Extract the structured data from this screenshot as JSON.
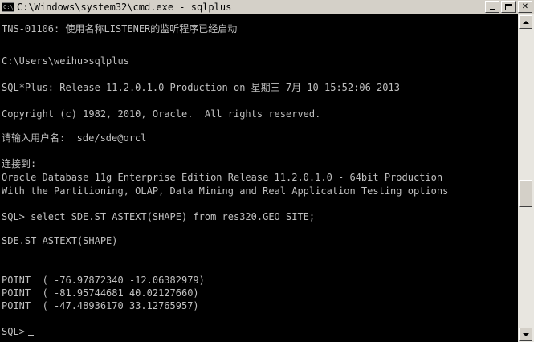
{
  "window": {
    "title": "C:\\Windows\\system32\\cmd.exe - sqlplus",
    "icon_label": "C:\\",
    "icon": "cmd-icon",
    "minimize_icon": "minimize-icon",
    "maximize_icon": "maximize-icon",
    "close_icon": "close-icon",
    "close_glyph": "✕"
  },
  "console": {
    "lines": [
      "TNS-01106: 使用名称LISTENER的监听程序已经启动",
      "",
      "C:\\Users\\weihu>sqlplus",
      "",
      "SQL*Plus: Release 11.2.0.1.0 Production on 星期三 7月 10 15:52:06 2013",
      "",
      "Copyright (c) 1982, 2010, Oracle.  All rights reserved.",
      "",
      "请输入用户名:  sde/sde@orcl",
      "",
      "连接到:",
      "Oracle Database 11g Enterprise Edition Release 11.2.0.1.0 - 64bit Production",
      "With the Partitioning, OLAP, Data Mining and Real Application Testing options",
      "",
      "SQL> select SDE.ST_ASTEXT(SHAPE) from res320.GEO_SITE;",
      "",
      "SDE.ST_ASTEXT(SHAPE)",
      "--------------------------------------------------------------------------------------------",
      "",
      "",
      "POINT  ( -76.97872340 -12.06382979)",
      "POINT  ( -81.95744681 40.02127660)",
      "POINT  ( -47.48936170 33.12765957)",
      "",
      "",
      "SQL>"
    ]
  },
  "scrollbar": {
    "up_icon": "scroll-up-arrow-icon",
    "down_icon": "scroll-down-arrow-icon"
  }
}
